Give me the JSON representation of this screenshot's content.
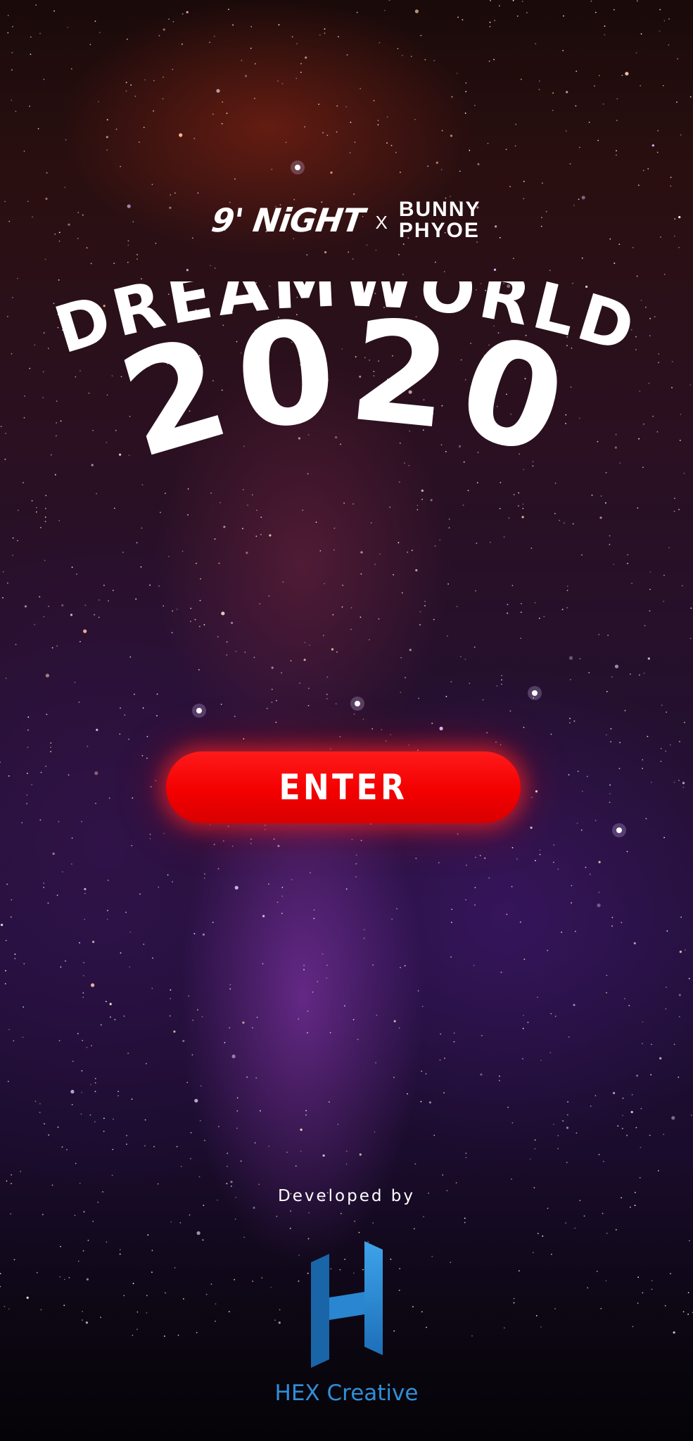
{
  "brand": {
    "left_name": "9' NiGHT",
    "separator": "X",
    "right_name_line1": "BUNNY",
    "right_name_line2": "PHYOE"
  },
  "title": {
    "line1": "DREAMWORLD",
    "line2": "2020"
  },
  "enter_button": {
    "label": "ENTER",
    "color": "#ff0000"
  },
  "footer": {
    "developed_by": "Developed by",
    "logo_letter": "H",
    "company": "HEX Creative",
    "brand_color": "#2f8fd8"
  },
  "background": {
    "icon": "starry-sky-background"
  }
}
